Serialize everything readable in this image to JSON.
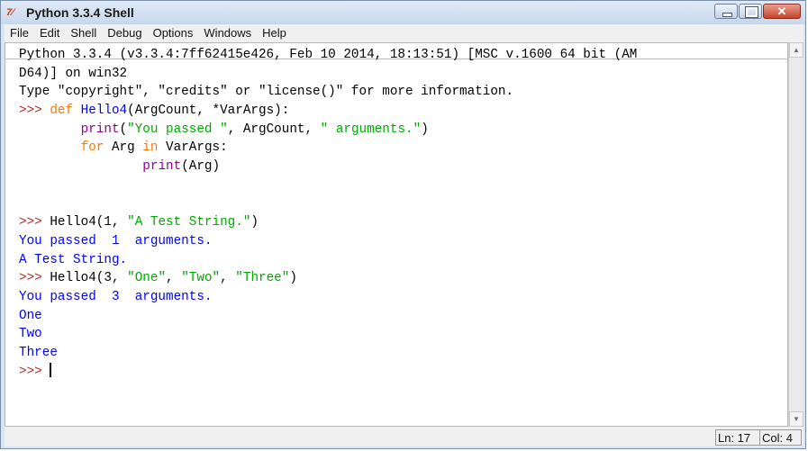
{
  "window": {
    "title": "Python 3.3.4 Shell",
    "icon": "tk-logo-icon",
    "controls": [
      "minimize-icon",
      "maximize-icon",
      "close-icon"
    ]
  },
  "menu": [
    "File",
    "Edit",
    "Shell",
    "Debug",
    "Options",
    "Windows",
    "Help"
  ],
  "shell": {
    "lines": [
      [
        {
          "t": "Python 3.3.4 (v3.3.4:7ff62415e426, Feb 10 2014, 18:13:51) [MSC v.1600 64 bit (AM",
          "c": "plain"
        }
      ],
      [
        {
          "t": "D64)] on win32",
          "c": "plain"
        }
      ],
      [
        {
          "t": "Type \"copyright\", \"credits\" or \"license()\" for more information.",
          "c": "plain"
        }
      ],
      [
        {
          "t": ">>> ",
          "c": "prompt"
        },
        {
          "t": "def ",
          "c": "kw"
        },
        {
          "t": "Hello4",
          "c": "def"
        },
        {
          "t": "(ArgCount, *VarArgs):",
          "c": "plain"
        }
      ],
      [
        {
          "t": "        ",
          "c": "plain"
        },
        {
          "t": "print",
          "c": "builtin"
        },
        {
          "t": "(",
          "c": "plain"
        },
        {
          "t": "\"You passed \"",
          "c": "str"
        },
        {
          "t": ", ArgCount, ",
          "c": "plain"
        },
        {
          "t": "\" arguments.\"",
          "c": "str"
        },
        {
          "t": ")",
          "c": "plain"
        }
      ],
      [
        {
          "t": "        ",
          "c": "plain"
        },
        {
          "t": "for ",
          "c": "kw"
        },
        {
          "t": "Arg ",
          "c": "plain"
        },
        {
          "t": "in ",
          "c": "kw"
        },
        {
          "t": "VarArgs:",
          "c": "plain"
        }
      ],
      [
        {
          "t": "                ",
          "c": "plain"
        },
        {
          "t": "print",
          "c": "builtin"
        },
        {
          "t": "(Arg)",
          "c": "plain"
        }
      ],
      [],
      [],
      [
        {
          "t": ">>> ",
          "c": "prompt"
        },
        {
          "t": "Hello4(1, ",
          "c": "plain"
        },
        {
          "t": "\"A Test String.\"",
          "c": "str"
        },
        {
          "t": ")",
          "c": "plain"
        }
      ],
      [
        {
          "t": "You passed  1  arguments.",
          "c": "out"
        }
      ],
      [
        {
          "t": "A Test String.",
          "c": "out"
        }
      ],
      [
        {
          "t": ">>> ",
          "c": "prompt"
        },
        {
          "t": "Hello4(3, ",
          "c": "plain"
        },
        {
          "t": "\"One\"",
          "c": "str"
        },
        {
          "t": ", ",
          "c": "plain"
        },
        {
          "t": "\"Two\"",
          "c": "str"
        },
        {
          "t": ", ",
          "c": "plain"
        },
        {
          "t": "\"Three\"",
          "c": "str"
        },
        {
          "t": ")",
          "c": "plain"
        }
      ],
      [
        {
          "t": "You passed  3  arguments.",
          "c": "out"
        }
      ],
      [
        {
          "t": "One",
          "c": "out"
        }
      ],
      [
        {
          "t": "Two",
          "c": "out"
        }
      ],
      [
        {
          "t": "Three",
          "c": "out"
        }
      ],
      [
        {
          "t": ">>> ",
          "c": "prompt"
        },
        {
          "t": "",
          "c": "caret"
        }
      ]
    ]
  },
  "status": {
    "line": "Ln: 17",
    "col": "Col: 4"
  },
  "colors": {
    "keyword": "#ff7700",
    "definition": "#0000ff",
    "string": "#00aa00",
    "builtin": "#900090",
    "output": "#0000ff",
    "prompt": "#a52a2a"
  }
}
